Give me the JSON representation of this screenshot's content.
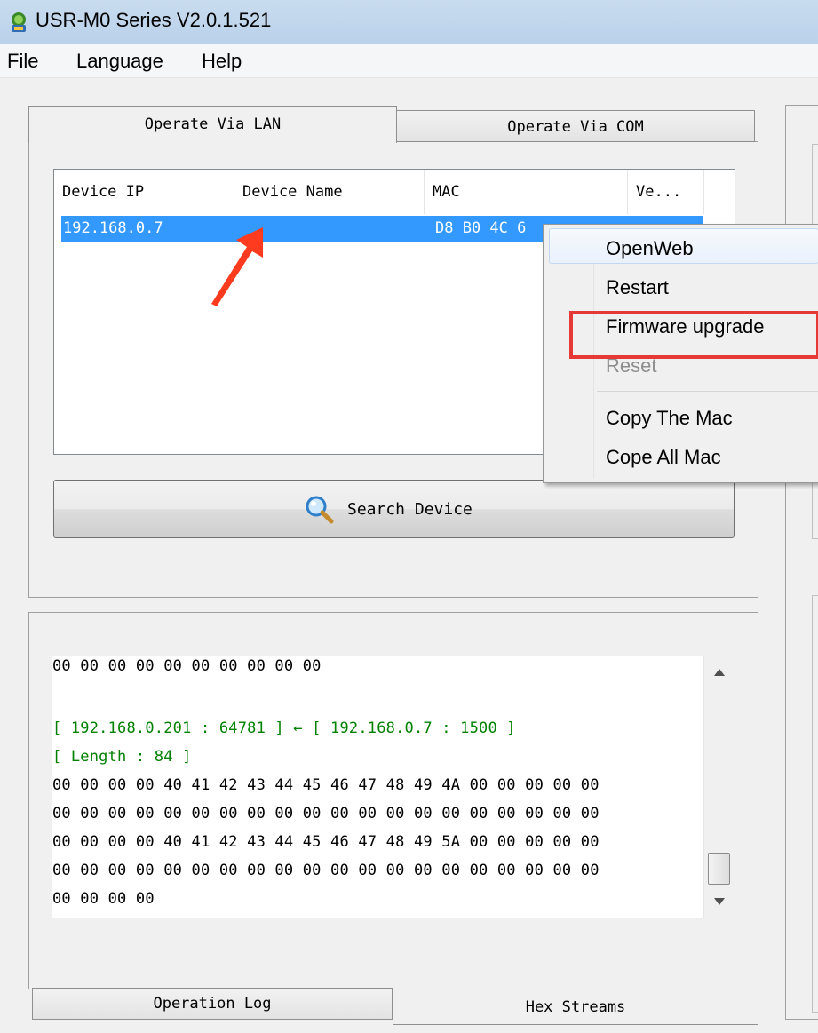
{
  "window": {
    "title": "USR-M0 Series V2.0.1.521"
  },
  "menu": {
    "file": "File",
    "language": "Language",
    "help": "Help"
  },
  "tabs": {
    "lan": "Operate Via LAN",
    "com": "Operate Via COM"
  },
  "device_table": {
    "columns": [
      "Device IP",
      "Device Name",
      "MAC",
      "Ve..."
    ],
    "rows": [
      {
        "ip": "192.168.0.7",
        "name": "",
        "mac": "D8 B0 4C 6"
      }
    ]
  },
  "search_button": "Search Device",
  "context_menu": {
    "items": [
      "OpenWeb",
      "Restart",
      "Firmware upgrade",
      "Reset",
      "Copy The Mac",
      "Cope All Mac"
    ]
  },
  "log": {
    "lines": [
      "00 00 00 00 00 00 00 00 00 00",
      "[ 192.168.0.201 : 64781 ] ← [ 192.168.0.7 : 1500 ]",
      "[ Length : 84 ]",
      "00 00 00 00 40 41 42 43 44 45 46 47 48 49 4A 00 00 00 00 00",
      "00 00 00 00 00 00 00 00 00 00 00 00 00 00 00 00 00 00 00 00",
      "00 00 00 00 40 41 42 43 44 45 46 47 48 49 5A 00 00 00 00 00",
      "00 00 00 00 00 00 00 00 00 00 00 00 00 00 00 00 00 00 00 00",
      "00 00 00 00"
    ]
  },
  "bottom_tabs": {
    "log": "Operation Log",
    "hex": "Hex Streams"
  },
  "colors": {
    "selection": "#3399ff",
    "log_green": "#008000",
    "highlight_box": "#e53935",
    "arrow": "#ff3b1f"
  }
}
